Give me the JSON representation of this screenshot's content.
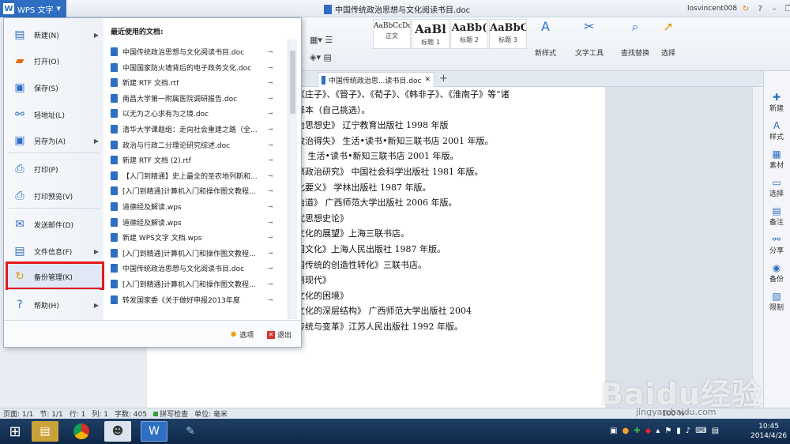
{
  "app": {
    "button_label": "WPS 文字"
  },
  "window": {
    "title": "中国传统政治思想与文化阅读书目.doc",
    "user": "losvincent008"
  },
  "ribbon": {
    "styles": [
      {
        "sample": "AaBbCcDd",
        "name": "正文"
      },
      {
        "sample": "AaBl",
        "name": "标题 1"
      },
      {
        "sample": "AaBb(",
        "name": "标题 2"
      },
      {
        "sample": "AaBbC",
        "name": "标题 3"
      }
    ],
    "new_style": "新样式",
    "text_tools": "文字工具",
    "find_replace": "查找替换",
    "select": "选择"
  },
  "tab": {
    "label": "中国传统政治思...读书目.doc"
  },
  "document_lines": [
    "《庄子》、《管子》、《荀子》、《韩非子》、《淮南子》等“诸",
    "译本（自己挑选）。",
    "治思想史》 辽宁教育出版社 1998 年版",
    "政治得失》 生活•读书•新知三联书店 2001 年版。",
    "》 生活•读书•新知三联书店 2001 年版。",
    "瘵政治研究》 中国社会科学出版社 1981 年版。",
    "化要义》 学林出版社 1987 年版。",
    "治道》 广西师范大学出版社 2006 年版。",
    "代思想史论》",
    "文化的展望》上海三联书店。",
    "国文化》上海人民出版社 1987 年版。",
    "国传统的创造性转化》三联书店。",
    "到现代》",
    "文化的困境》",
    "文化的深层结构》 广西师范大学出版社 2004",
    "传统与变革》江苏人民出版社 1992 年版。"
  ],
  "right_sidebar": [
    "新建",
    "样式",
    "素材",
    "选择",
    "备注",
    "分享",
    "备份",
    "限制"
  ],
  "menu": {
    "items": [
      {
        "label": "新建(N)",
        "icon": "new-doc-icon",
        "arrow": true
      },
      {
        "label": "打开(O)",
        "icon": "open-folder-icon",
        "arrow": false
      },
      {
        "label": "保存(S)",
        "icon": "save-icon",
        "arrow": false
      },
      {
        "label": "轻地址(L)",
        "icon": "link-icon",
        "arrow": false
      },
      {
        "label": "另存为(A)",
        "icon": "save-as-icon",
        "arrow": true
      },
      {
        "label": "打印(P)",
        "icon": "print-icon",
        "arrow": false
      },
      {
        "label": "打印预览(V)",
        "icon": "print-preview-icon",
        "arrow": false
      },
      {
        "label": "发送邮件(D)",
        "icon": "mail-icon",
        "arrow": false
      },
      {
        "label": "文件信息(F)",
        "icon": "file-info-icon",
        "arrow": true
      },
      {
        "label": "备份管理(K)",
        "icon": "backup-icon",
        "arrow": false
      },
      {
        "label": "帮助(H)",
        "icon": "help-icon",
        "arrow": true
      }
    ],
    "recent_title": "最近使用的文档:",
    "recent": [
      "中国传统政治思想与文化阅读书目.doc",
      "中国国家防火墙背后的电子政务文化.doc",
      "新建 RTF 文档.rtf",
      "南昌大学第一附属医院调研报告.doc",
      "以无为之心求有为之境.doc",
      "清华大学课题组：走向社会重建之路（全...",
      "政治与行政二分理论研究综述.doc",
      "新建 RTF 文档 (2).rtf",
      "【入门到精通】史上最全的圣农地列斯和...",
      "[入门到精通]计算机入门和操作图文教程...",
      "道德经及解读.wps",
      "道德经及解读.wps",
      "新建 WPS文字 文档.wps",
      "[入门到精通]计算机入门和操作图文教程...",
      "中国传统政治思想与文化阅读书目.doc",
      "[入门到精通]计算机入门和操作图文教程...",
      "转发国家委《关于做好申报2013年度"
    ],
    "options": "选项",
    "exit": "退出"
  },
  "status": {
    "page": "页面: 1/1",
    "section": "节: 1/1",
    "row": "行: 1",
    "col": "列: 1",
    "words": "字数: 405",
    "spell": "拼写检查",
    "unit": "单位: 毫米",
    "zoom": "100 %"
  },
  "taskbar": {
    "time": "10:45",
    "date": "2014/4/26"
  },
  "watermark": {
    "text": "Baidu经验",
    "url": "jingyan.baidu.com"
  }
}
